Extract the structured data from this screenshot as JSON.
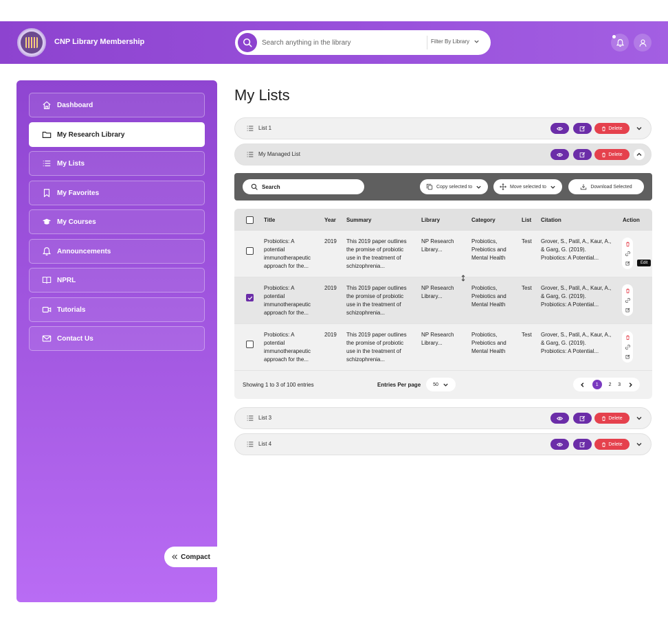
{
  "header": {
    "brand": "CNP Library Membership",
    "search_placeholder": "Search anything in the library",
    "filter_label": "Filter By Library"
  },
  "sidebar": {
    "items": [
      {
        "label": "Dashboard",
        "icon": "home-icon"
      },
      {
        "label": "My Research Library",
        "icon": "folder-icon"
      },
      {
        "label": "My Lists",
        "icon": "list-icon"
      },
      {
        "label": "My Favorites",
        "icon": "bookmark-icon"
      },
      {
        "label": "My Courses",
        "icon": "graduation-cap-icon"
      },
      {
        "label": "Announcements",
        "icon": "bell-icon"
      },
      {
        "label": "NPRL",
        "icon": "book-icon"
      },
      {
        "label": "Tutorials",
        "icon": "video-icon"
      },
      {
        "label": "Contact Us",
        "icon": "mail-icon"
      }
    ],
    "active_item": "My Research Library",
    "compact_label": "Compact"
  },
  "main": {
    "title": "My Lists",
    "delete_label": "Delete",
    "lists": [
      {
        "name": "List 1",
        "expanded": false
      },
      {
        "name": "My Managed List",
        "expanded": true
      },
      {
        "name": "List 3",
        "expanded": false
      },
      {
        "name": "List 4",
        "expanded": false
      }
    ],
    "toolbar": {
      "search_placeholder": "Search",
      "copy_label": "Copy selected to",
      "move_label": "Move selected to",
      "download_label": "Download Selected"
    },
    "table": {
      "columns": [
        "Title",
        "Year",
        "Summary",
        "Library",
        "Category",
        "List",
        "Citation",
        "Action"
      ],
      "rows": [
        {
          "checked": false,
          "title": [
            "Probiotics: A",
            "potential",
            "immunotherapeutic",
            "approach for the..."
          ],
          "year": "2019",
          "summary": [
            "This 2019 paper outlines",
            "the promise of probiotic",
            "use in the treatment of",
            "schizophrenia..."
          ],
          "library": [
            "NP Research",
            "Library..."
          ],
          "category": [
            "Probiotics,",
            "Prebiotics and",
            "Mental Health"
          ],
          "list": "Test",
          "citation": [
            "Grover, S., Patil, A., Kaur, A.,",
            "& Garg, G. (2019).",
            "Probiotics: A Potential..."
          ]
        },
        {
          "checked": true,
          "title": [
            "Probiotics: A",
            "potential",
            "immunotherapeutic",
            "approach for the..."
          ],
          "year": "2019",
          "summary": [
            "This 2019 paper outlines",
            "the promise of probiotic",
            "use in the treatment of",
            "schizophrenia..."
          ],
          "library": [
            "NP Research",
            "Library..."
          ],
          "category": [
            "Probiotics,",
            "Prebiotics and",
            "Mental Health"
          ],
          "list": "Test",
          "citation": [
            "Grover, S., Patil, A., Kaur, A.,",
            "& Garg, G. (2019).",
            "Probiotics: A Potential..."
          ]
        },
        {
          "checked": false,
          "title": [
            "Probiotics: A",
            "potential",
            "immunotherapeutic",
            "approach for the..."
          ],
          "year": "2019",
          "summary": [
            "This 2019 paper outlines",
            "the promise of probiotic",
            "use in the treatment of",
            "schizophrenia..."
          ],
          "library": [
            "NP Research",
            "Library..."
          ],
          "category": [
            "Probiotics,",
            "Prebiotics and",
            "Mental Health"
          ],
          "list": "Test",
          "citation": [
            "Grover, S., Patil, A., Kaur, A.,",
            "& Garg, G. (2019).",
            "Probiotics: A Potential..."
          ]
        }
      ],
      "tooltip": "Edit",
      "showing": "Showing 1 to 3 of 100 entries",
      "entries_label": "Entries Per page",
      "entries_value": "50",
      "pages": [
        "1",
        "2",
        "3"
      ],
      "current_page": "1"
    }
  },
  "colors": {
    "brand_purple": "#8d43cf",
    "action_purple": "#6b2da8",
    "delete_red": "#e5414d"
  }
}
